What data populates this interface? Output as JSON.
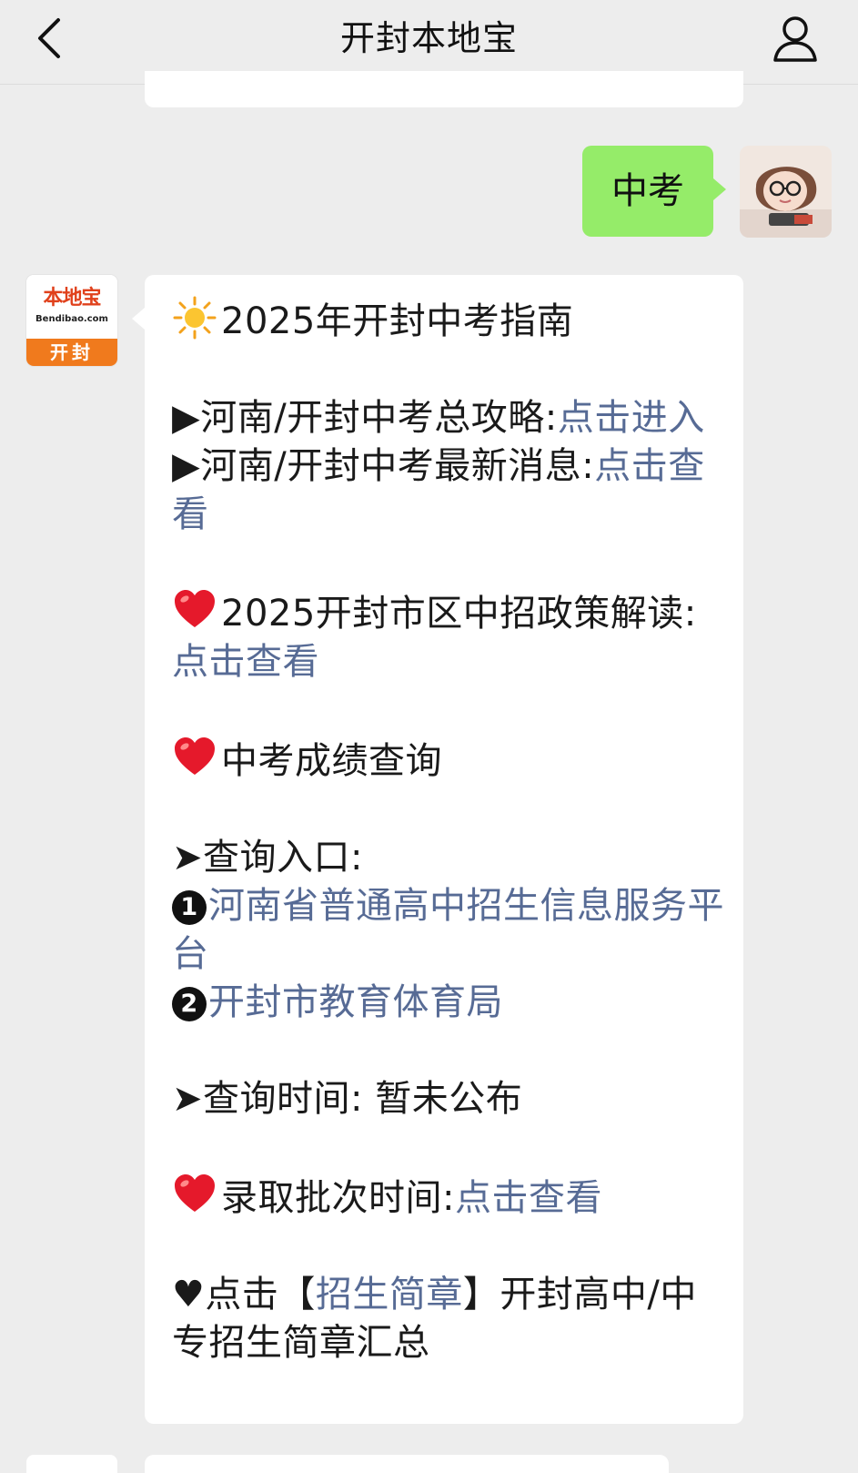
{
  "header": {
    "title": "开封本地宝",
    "back_icon": "chevron-left-icon",
    "profile_icon": "user-icon"
  },
  "sent_message": {
    "text": "中考"
  },
  "bot": {
    "logo_text": "本地宝",
    "logo_domain": "Bendibao.com",
    "logo_city": "开封",
    "logo_colors": {
      "main": "#e0411c",
      "band": "#f07a1d"
    }
  },
  "message": {
    "title": "2025年开封中考指南",
    "line1_label": "▶河南/开封中考总攻略:",
    "line1_link": "点击进入",
    "line2_label": "▶河南/开封中考最新消息:",
    "line2_link": "点击查看",
    "policy_label": "2025开封市区中招政策解读:",
    "policy_link": "点击查看",
    "score_heading": "中考成绩查询",
    "entry_label": "➤查询入口:",
    "entry1_num": "1",
    "entry1_link": "河南省普通高中招生信息服务平台",
    "entry2_num": "2",
    "entry2_link": "开封市教育体育局",
    "time_label": "➤查询时间:",
    "time_value": "暂未公布",
    "batch_label": "录取批次时间:",
    "batch_link": "点击查看",
    "brochure_prefix": "♥点击【",
    "brochure_link": "招生简章",
    "brochure_suffix": "】开封高中/中专招生简章汇总"
  },
  "colors": {
    "link": "#576b95",
    "sent_bubble": "#95ec69",
    "background": "#ededed"
  },
  "icons": {
    "sun": "sun-emoji-icon",
    "heart": "red-heart-emoji-icon"
  }
}
